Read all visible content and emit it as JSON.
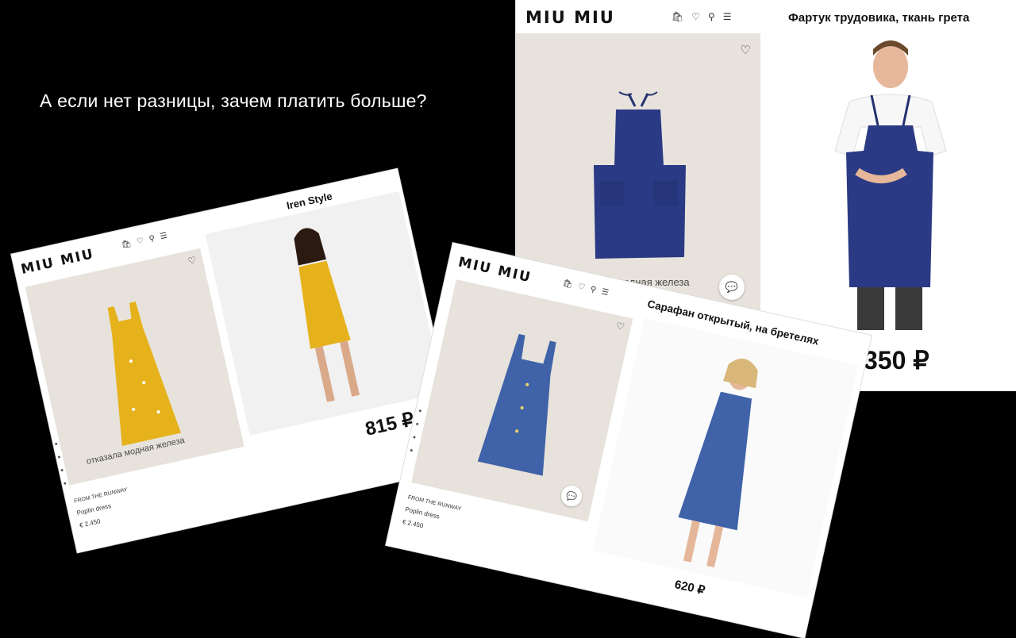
{
  "headline": "А если нет разницы, зачем платить больше?",
  "card_yellow": {
    "logo": "MIU MIU",
    "store_title": "Iren Style",
    "watermark": "отказала модная железа",
    "runway_label": "FROM THE RUNWAY",
    "product_name": "Poplin dress",
    "product_price": "€ 2.450",
    "compare_price": "815 ₽"
  },
  "card_apron": {
    "logo": "MIU MIU",
    "store_title": "Фартук трудовика, ткань грета",
    "watermark": "а модная железа",
    "compare_price": "350 ₽"
  },
  "card_blue": {
    "logo": "MIU MIU",
    "store_title": "Сарафан открытый, на бретелях",
    "runway_label": "FROM THE RUNWAY",
    "product_name": "Poplin dress",
    "product_price": "€ 2.450",
    "compare_price": "620 ₽"
  },
  "colors": {
    "background": "#000000",
    "yellow_dress": "#e6b21c",
    "navy_apron": "#2b3a84",
    "blue_dress": "#3f62a8"
  }
}
